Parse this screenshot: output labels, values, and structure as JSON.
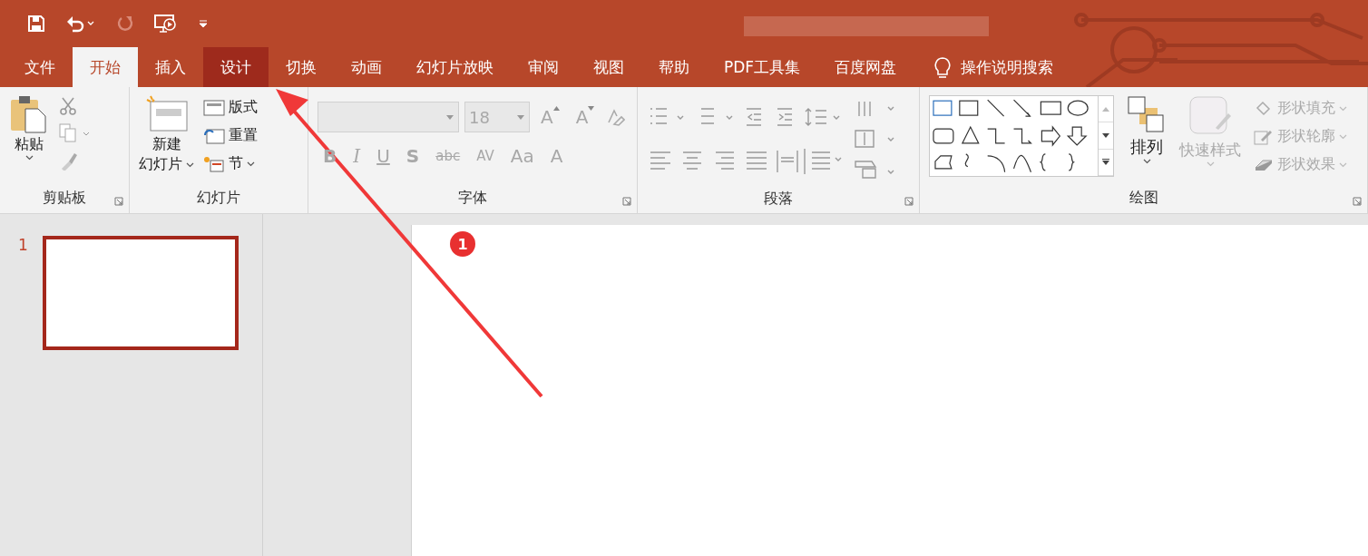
{
  "tabs": [
    {
      "label": "文件",
      "selected": false,
      "highlighted": false
    },
    {
      "label": "开始",
      "selected": true,
      "highlighted": false
    },
    {
      "label": "插入",
      "selected": false,
      "highlighted": false
    },
    {
      "label": "设计",
      "selected": false,
      "highlighted": true
    },
    {
      "label": "切换",
      "selected": false,
      "highlighted": false
    },
    {
      "label": "动画",
      "selected": false,
      "highlighted": false
    },
    {
      "label": "幻灯片放映",
      "selected": false,
      "highlighted": false
    },
    {
      "label": "审阅",
      "selected": false,
      "highlighted": false
    },
    {
      "label": "视图",
      "selected": false,
      "highlighted": false
    },
    {
      "label": "帮助",
      "selected": false,
      "highlighted": false
    },
    {
      "label": "PDF工具集",
      "selected": false,
      "highlighted": false
    },
    {
      "label": "百度网盘",
      "selected": false,
      "highlighted": false
    }
  ],
  "tell_me": {
    "placeholder": "操作说明搜索"
  },
  "clipboard": {
    "label": "剪贴板",
    "paste": "粘贴"
  },
  "slides": {
    "label": "幻灯片",
    "new_slide": [
      "新建",
      "幻灯片"
    ],
    "layout": "版式",
    "reset": "重置",
    "section": "节"
  },
  "font": {
    "label": "字体",
    "disabled": true,
    "size": "18",
    "buttons": [
      "B",
      "I",
      "U",
      "S",
      "abc",
      "AV",
      "Aa",
      "A"
    ],
    "grow": "A",
    "shrink": "A"
  },
  "paragraph": {
    "label": "段落"
  },
  "drawing": {
    "label": "绘图",
    "arrange": "排列",
    "quick_styles": "快速样式",
    "fill": "形状填充",
    "outline": "形状轮廓",
    "effects": "形状效果"
  },
  "thumbnails": [
    {
      "number": "1",
      "selected": true
    }
  ],
  "annotation": {
    "badge": "1"
  }
}
